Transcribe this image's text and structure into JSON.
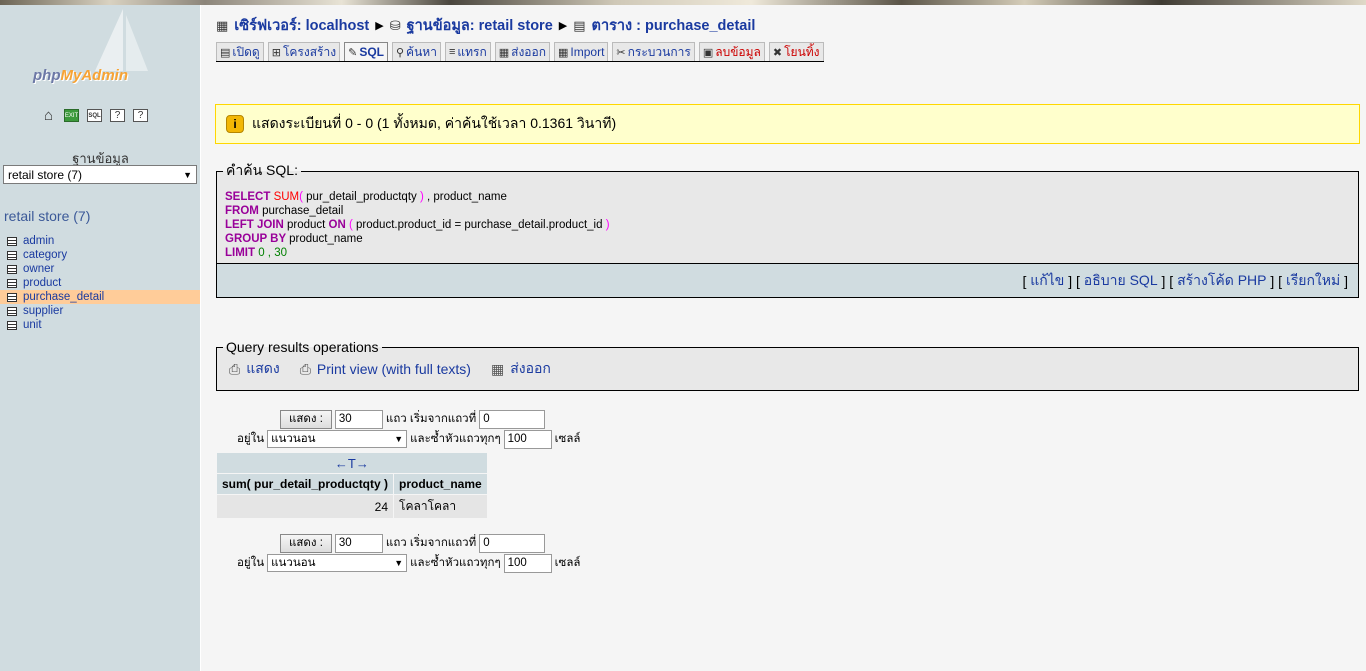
{
  "sidebar": {
    "logo": {
      "pre": "php",
      "hl": "MyAdmin"
    },
    "db_heading": "ฐานข้อมูล",
    "db_select": "retail store (7)",
    "db_title": "retail store (7)",
    "tables": [
      {
        "label": "admin"
      },
      {
        "label": "category"
      },
      {
        "label": "owner"
      },
      {
        "label": "product"
      },
      {
        "label": "purchase_detail"
      },
      {
        "label": "supplier"
      },
      {
        "label": "unit"
      }
    ]
  },
  "breadcrumb": {
    "server": "เซิร์ฟเวอร์: localhost",
    "database": "ฐานข้อมูล: retail store",
    "table": "ตาราง : purchase_detail"
  },
  "tabs": [
    "เปิดดู",
    "โครงสร้าง",
    "SQL",
    "ค้นหา",
    "แทรก",
    "ส่งออก",
    "Import",
    "กระบวนการ",
    "ลบข้อมูล",
    "โยนทิ้ง"
  ],
  "notice": "แสดงระเบียนที่ 0 - 0 (1 ทั้งหมด, ค่าค้นใช้เวลา 0.1361 วินาที)",
  "sql": {
    "legend": "คำค้น SQL:",
    "lines": [
      [
        {
          "c": "kw",
          "t": "SELECT "
        },
        {
          "c": "fn",
          "t": "SUM"
        },
        {
          "c": "pn",
          "t": "( "
        },
        {
          "c": "",
          "t": "pur_detail_productqty"
        },
        {
          "c": "pn",
          "t": " )"
        },
        {
          "c": "",
          "t": " , product_name"
        }
      ],
      [
        {
          "c": "kw",
          "t": "FROM "
        },
        {
          "c": "",
          "t": "purchase_detail"
        }
      ],
      [
        {
          "c": "kw",
          "t": "LEFT JOIN "
        },
        {
          "c": "",
          "t": "product "
        },
        {
          "c": "kw",
          "t": "ON "
        },
        {
          "c": "pn",
          "t": "( "
        },
        {
          "c": "",
          "t": "product.product_id = purchase_detail.product_id"
        },
        {
          "c": "pn",
          "t": " )"
        }
      ],
      [
        {
          "c": "kw",
          "t": "GROUP BY "
        },
        {
          "c": "",
          "t": "product_name"
        }
      ],
      [
        {
          "c": "kw",
          "t": "LIMIT "
        },
        {
          "c": "nm",
          "t": "0 , 30"
        }
      ]
    ],
    "actions": [
      "แก้ไข",
      "อธิบาย SQL",
      "สร้างโค้ด PHP",
      "เรียกใหม่"
    ]
  },
  "qr": {
    "legend": "Query results operations",
    "links": [
      "แสดง",
      "Print view (with full texts)",
      "ส่งออก"
    ]
  },
  "nav": {
    "show_btn": "แสดง :",
    "rows": "30",
    "rows_label": "แถว เริ่มจากแถวที่",
    "start": "0",
    "in_label": "อยู่ใน",
    "mode": "แนวนอน",
    "repeat_label": "และซ้ำหัวแถวทุกๆ",
    "repeat": "100",
    "cells_label": "เซลล์"
  },
  "results": {
    "sort_arrows": "←T→",
    "columns": [
      "sum( pur_detail_productqty )",
      "product_name"
    ],
    "rows": [
      [
        "24",
        "โคลาโคลา"
      ]
    ]
  }
}
